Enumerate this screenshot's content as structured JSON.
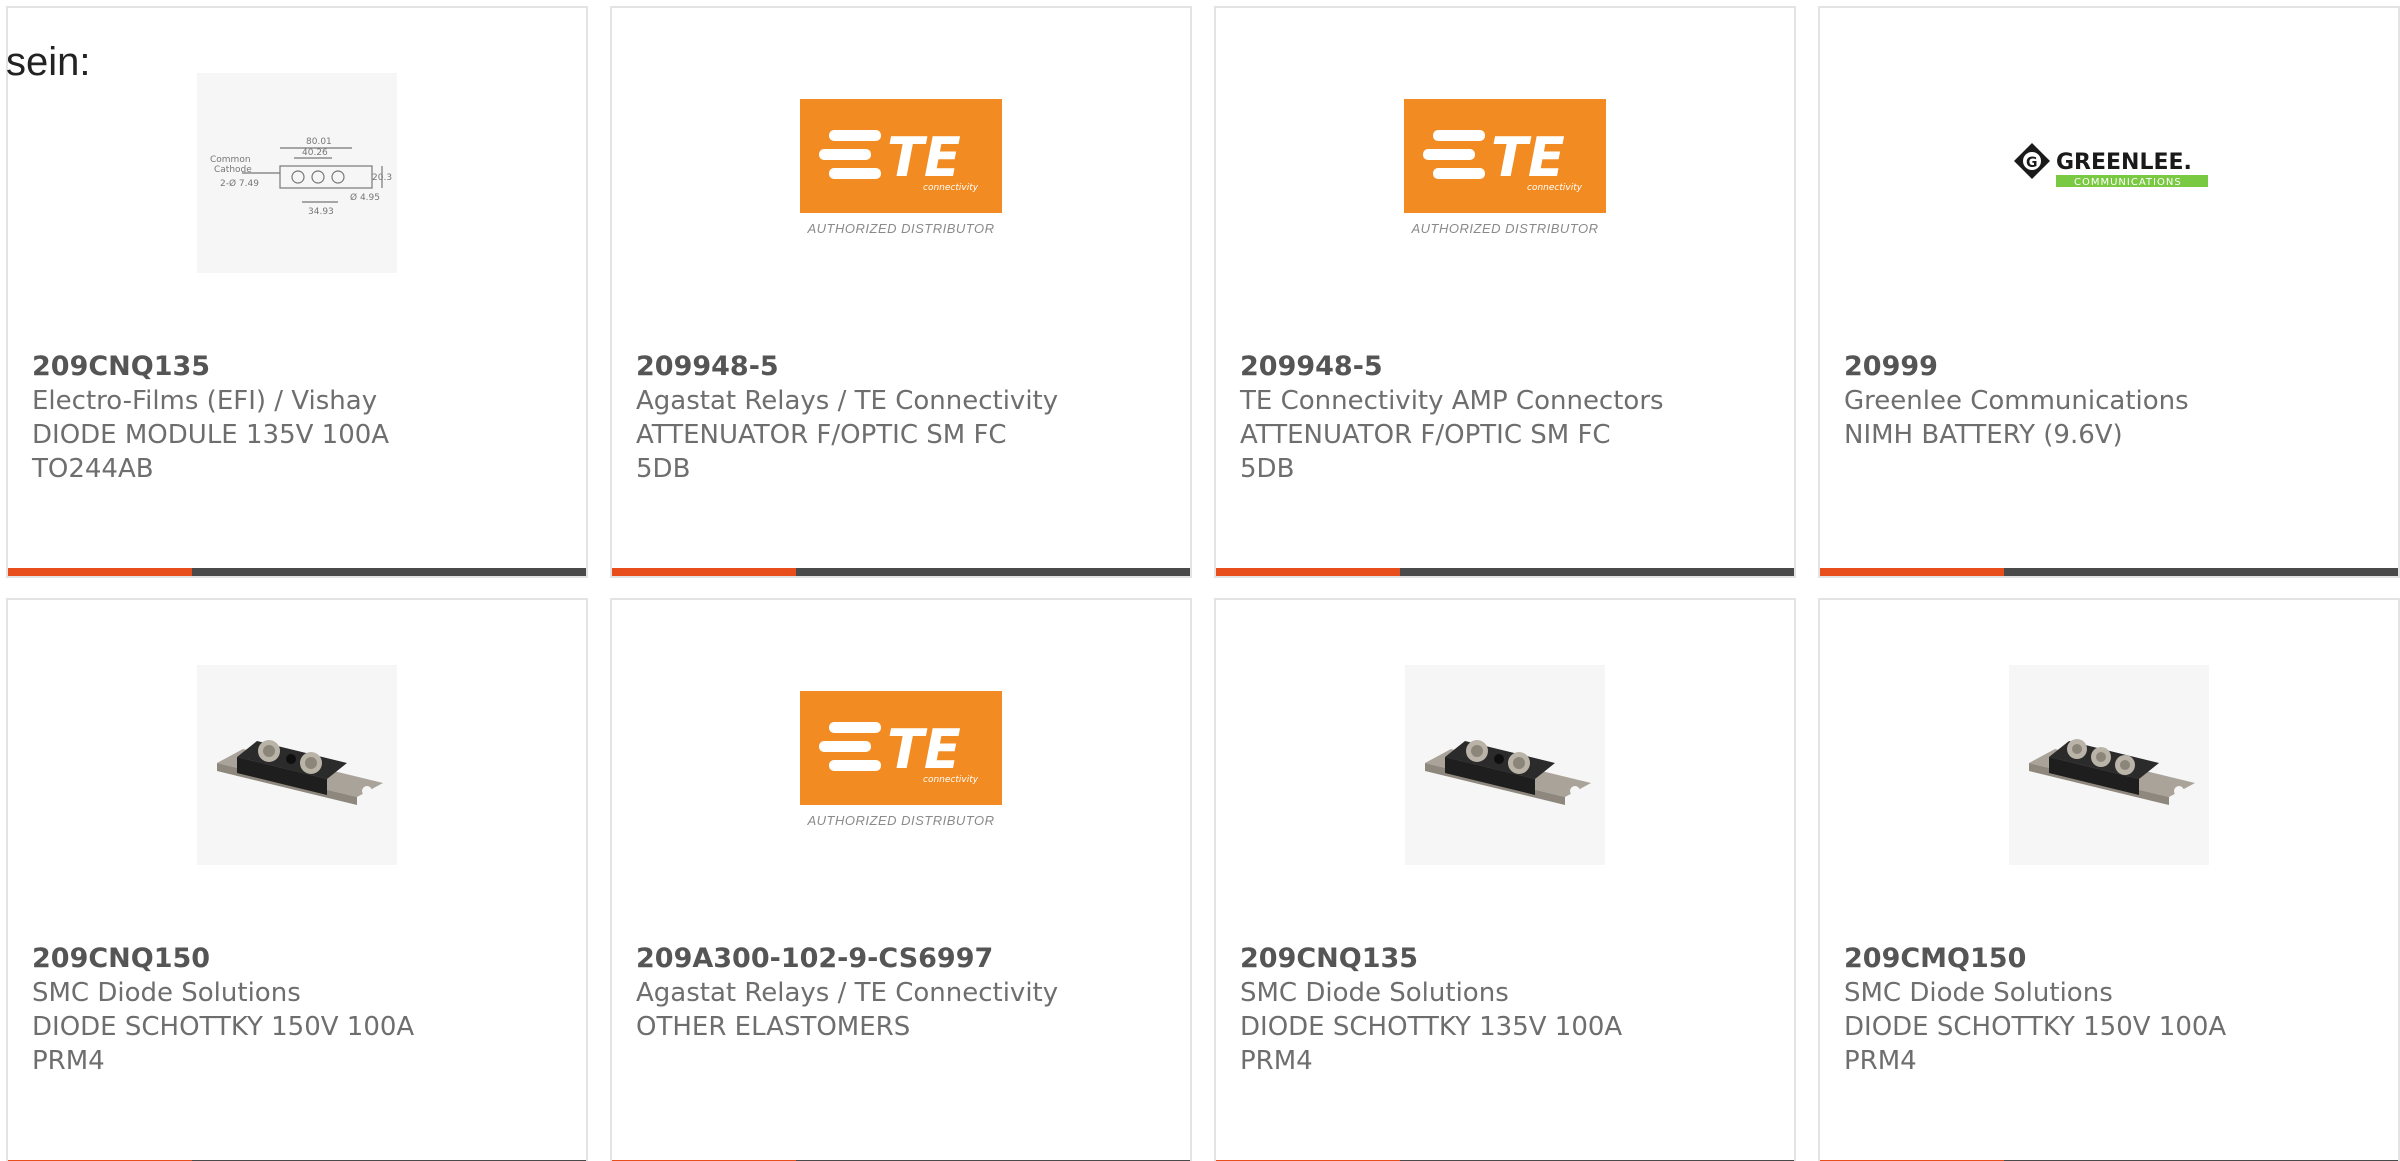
{
  "header": {
    "lead_text": "sein:"
  },
  "te_logo": {
    "caption": "AUTHORIZED DISTRIBUTOR"
  },
  "colors": {
    "accent": "#e84e1b",
    "bar": "#4a4a4a",
    "te_orange": "#f28c22",
    "greenlee_green": "#7ac943"
  },
  "products": [
    {
      "part_number": "209CNQ135",
      "manufacturer": "Electro-Films (EFI) / Vishay",
      "description": "DIODE MODULE 135V 100A\nTO244AB",
      "image_icon": "diode-drawing-image"
    },
    {
      "part_number": "209948-5",
      "manufacturer": "Agastat Relays / TE Connectivity",
      "description": "ATTENUATOR F/OPTIC SM FC\n5DB",
      "image_icon": "te-connectivity-logo"
    },
    {
      "part_number": "209948-5",
      "manufacturer": "TE Connectivity AMP Connectors",
      "description": "ATTENUATOR F/OPTIC SM FC\n5DB",
      "image_icon": "te-connectivity-logo"
    },
    {
      "part_number": "20999",
      "manufacturer": "Greenlee Communications",
      "description": "NIMH BATTERY (9.6V)",
      "image_icon": "greenlee-logo"
    },
    {
      "part_number": "209CNQ150",
      "manufacturer": "SMC Diode Solutions",
      "description": "DIODE SCHOTTKY 150V 100A\nPRM4",
      "image_icon": "diode-module-image"
    },
    {
      "part_number": "209A300-102-9-CS6997",
      "manufacturer": "Agastat Relays / TE Connectivity",
      "description": "OTHER ELASTOMERS",
      "image_icon": "te-connectivity-logo"
    },
    {
      "part_number": "209CNQ135",
      "manufacturer": "SMC Diode Solutions",
      "description": "DIODE SCHOTTKY 135V 100A\nPRM4",
      "image_icon": "diode-module-image"
    },
    {
      "part_number": "209CMQ150",
      "manufacturer": "SMC Diode Solutions",
      "description": "DIODE SCHOTTKY 150V 100A\nPRM4",
      "image_icon": "diode-module-3-terminal-image"
    }
  ]
}
